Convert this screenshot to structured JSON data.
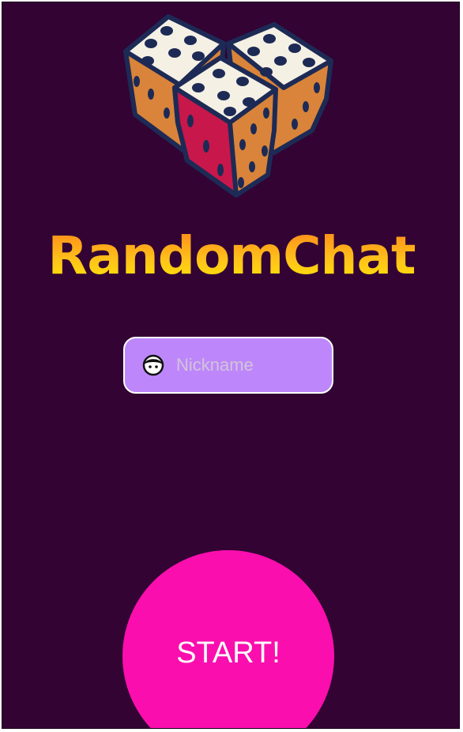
{
  "app": {
    "title": "RandomChat",
    "logo_icon": "dice-icon"
  },
  "nickname": {
    "placeholder": "Nickname",
    "value": "",
    "icon": "face-icon"
  },
  "start_button": {
    "label": "START!"
  },
  "colors": {
    "background": "#320333",
    "input_background": "#bd87fb",
    "start_button": "#fb0eae",
    "title_gradient_top": "#ff7a1a",
    "title_gradient_bottom": "#fff200"
  }
}
